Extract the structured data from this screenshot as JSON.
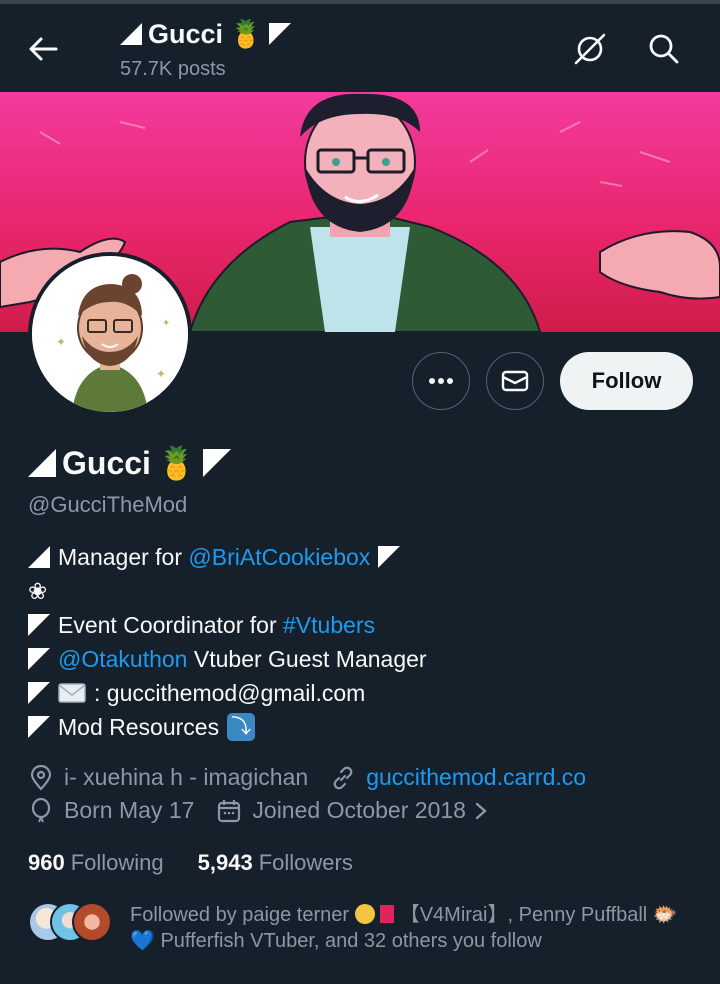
{
  "header": {
    "title": "Gucci",
    "posts": "57.7K posts",
    "back_icon": "arrow-left-icon",
    "icons": [
      "grok-icon",
      "search-icon"
    ]
  },
  "profile": {
    "name": "Gucci",
    "handle": "@GucciTheMod",
    "follow_label": "Follow",
    "more_icon": "more-icon",
    "message_icon": "mail-icon"
  },
  "bio": {
    "line1_prefix": "Manager for ",
    "line1_mention": "@BriAtCookiebox",
    "line2_symbol": "❀",
    "line3_prefix": "Event Coordinator for ",
    "line3_hashtag": "#Vtubers",
    "line4_mention": "@Otakuthon",
    "line4_suffix": " Vtuber Guest Manager",
    "line5_email": ": guccithemod@gmail.com",
    "line6_text": "Mod Resources",
    "line6_emoji": "⤵"
  },
  "meta": {
    "location": "i- xuehina h - imagichan",
    "website": "guccithemod.carrd.co",
    "birthday": "Born May 17",
    "joined": "Joined October 2018"
  },
  "stats": {
    "following_count": "960",
    "following_label": "Following",
    "followers_count": "5,943",
    "followers_label": "Followers"
  },
  "followed_by": {
    "part1": "Followed by paige terner",
    "part2": "【V4Mirai】, Penny Puffball",
    "part3": "Pufferfish VTuber, and 32 others you follow"
  },
  "colors": {
    "background": "#15202b",
    "accent": "#1d9bf0",
    "secondary_text": "#8b98a5",
    "banner_pink": "#ef2a7f"
  }
}
